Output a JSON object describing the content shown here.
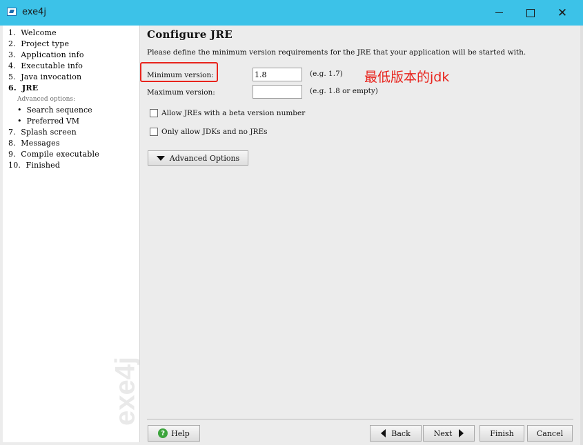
{
  "window": {
    "title": "exe4j",
    "colors": {
      "titlebar": "#3cc2e8",
      "annotation_red": "#e8231c",
      "help_green": "#3ca43c"
    }
  },
  "sidebar": {
    "items": [
      {
        "label": "1.  Welcome",
        "active": false
      },
      {
        "label": "2.  Project type",
        "active": false
      },
      {
        "label": "3.  Application info",
        "active": false
      },
      {
        "label": "4.  Executable info",
        "active": false
      },
      {
        "label": "5.  Java invocation",
        "active": false
      },
      {
        "label": "6.  JRE",
        "active": true
      },
      {
        "label": "7.  Splash screen",
        "active": false
      },
      {
        "label": "8.  Messages",
        "active": false
      },
      {
        "label": "9.  Compile executable",
        "active": false
      },
      {
        "label": "10.  Finished",
        "active": false
      }
    ],
    "advanced_header": "Advanced options:",
    "sub_items": [
      {
        "label": "•  Search sequence"
      },
      {
        "label": "•  Preferred VM"
      }
    ],
    "watermark": "exe4j"
  },
  "main": {
    "title": "Configure JRE",
    "description": "Please define the minimum version requirements for the JRE that your application will be started with.",
    "min_version": {
      "label": "Minimum version:",
      "value": "1.8",
      "hint": "(e.g. 1.7)"
    },
    "max_version": {
      "label": "Maximum version:",
      "value": "",
      "hint": "(e.g. 1.8 or empty)"
    },
    "annotation": "最低版本的jdk",
    "checkboxes": [
      {
        "label": "Allow JREs with a beta version number",
        "checked": false
      },
      {
        "label": "Only allow JDKs and no JREs",
        "checked": false
      }
    ],
    "advanced_button": "Advanced Options"
  },
  "footer": {
    "help": "Help",
    "back": "Back",
    "next": "Next",
    "finish": "Finish",
    "cancel": "Cancel"
  }
}
